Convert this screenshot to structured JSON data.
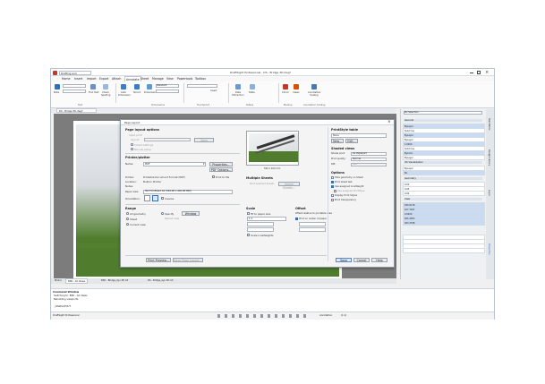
{
  "app": {
    "title": "DraftSight Professional - DS - Bridge 3D.dwg*",
    "workspace": "Drafting and Annotation",
    "menu": [
      "Home",
      "Insert",
      "Import",
      "Export",
      "Attach",
      "Annotate",
      "Sheet",
      "Manage",
      "View",
      "Powertools",
      "Toolbox"
    ],
    "ribbon": {
      "groups": [
        "Text",
        "Dimensions",
        "Touchpoint",
        "Tables",
        "Markup",
        "Annotation Scaling"
      ],
      "buttons": [
        "Note",
        "Find Text",
        "Check Spelling",
        "Auto Dimension",
        "Smart",
        "Dimension",
        "Insert",
        "Data Extraction",
        "Table",
        "Cloud",
        "Views",
        "Annotative Scaling"
      ],
      "style_value": "Standard"
    },
    "doc_tab": "DS - Bridge 3D.dwg*",
    "layout_tabs": [
      "Model",
      "B3D - A2 Views",
      "B3D - Bridge_Ayu 3D A3",
      "DS - Bridge_Ayu 3D A3"
    ],
    "command_window": {
      "title": "Command Window",
      "lines": [
        "Switching to: B3D - A2 Views",
        "Rebuilding viewports.",
        ":_PAGELAYOUT"
      ]
    },
    "status_left": "DraftSight Professional",
    "status_right": "Annotation",
    "status_scale": "(1:1)"
  },
  "right_panel": {
    "header": "No Selection",
    "sections": [
      "General",
      "3D Visualization",
      "Geometry",
      "View"
    ],
    "rows": [
      "ByLayer",
      "Solid line",
      "ByLayer",
      "ByLayer",
      "1.0000",
      "Solid line",
      "ByColor",
      "ByLayer",
      "ByLayer",
      "No",
      "0.00",
      "0.00",
      "0.00",
      "184.6178",
      "107.7037",
      "0.0000",
      "825.4053",
      "363.3338"
    ],
    "vtabs": [
      "Properties",
      "Tool Matrix",
      "Design Library",
      "Layer"
    ]
  },
  "dialog": {
    "title": "Page Layout",
    "sections": {
      "page_layout_options": "Page layout options",
      "printer": "Printer/plotter",
      "multiple_sheets": "Multiple Sheets",
      "range": "Range",
      "scale": "Scale",
      "offset": "Offset",
      "printstyle_table": "PrintStyle table",
      "shaded_views": "Shaded views",
      "options": "Options"
    },
    "layout_name_label": "Layout",
    "layout_name_value": "",
    "inherit_label": "Inherit settings",
    "manual_label": "Manual setup",
    "print_label": "Input print",
    "save_btn": "Save",
    "name_label": "Name:",
    "name_value": "PDF",
    "properties_btn": "Properties...",
    "pdf_options_btn": "PDF Options...",
    "printer_label": "Printer:",
    "printer_value": "Printable Document Format (PDF)",
    "location_label": "Location:",
    "location_value": "Built-In Printer",
    "notes_label": "Notes:",
    "print_to_file": "Print to file",
    "paper_size_label": "Paper size:",
    "paper_size_value": "ISO Full Bleed A2 (594.00 x 420.00 MM)",
    "orientation_label": "Orientation:",
    "inverse_label": "Inverse",
    "preview_size": "594 x 420 mm",
    "range_options": [
      "All geometry",
      "Sheet",
      "Current view"
    ],
    "range_specify": "Specify",
    "range_window_btn": "Window",
    "range_named": "Named view",
    "fit_label": "Fit to paper size",
    "scale_value": "1:1",
    "scale_lineweights": "Scale LineWeights",
    "offset_label": "Offset relative to printable area",
    "center_label": "Print on center of paper",
    "print_selected_sheets": "Print selected Sheets",
    "select_sheets_btn": "Select Sheets...",
    "printstyle_value": "None",
    "new_btn": "New...",
    "edit_btn": "Edit...",
    "shade_print_label": "Shade print:",
    "shade_print_value": "As displayed",
    "print_quality_label": "Print quality:",
    "print_quality_value": "Normal",
    "dpi_label": "DPI:",
    "dpi_value": "100",
    "options_list": [
      "Hide geometry on Sheet",
      "Print sheet last",
      "Use assigned LineWeight",
      "Use assigned PrintStyle",
      "Display Print Styles",
      "Print transparency"
    ],
    "preview_btn": "Print Preview...",
    "layout_btn": "Save Page Layout...",
    "ok_btn": "Save",
    "cancel_btn": "Cancel",
    "help_btn": "Help"
  },
  "colors": {
    "accent": "#2f6fbf",
    "canvas": "#7c7c7c",
    "green_ground": "#4f7d2d"
  }
}
